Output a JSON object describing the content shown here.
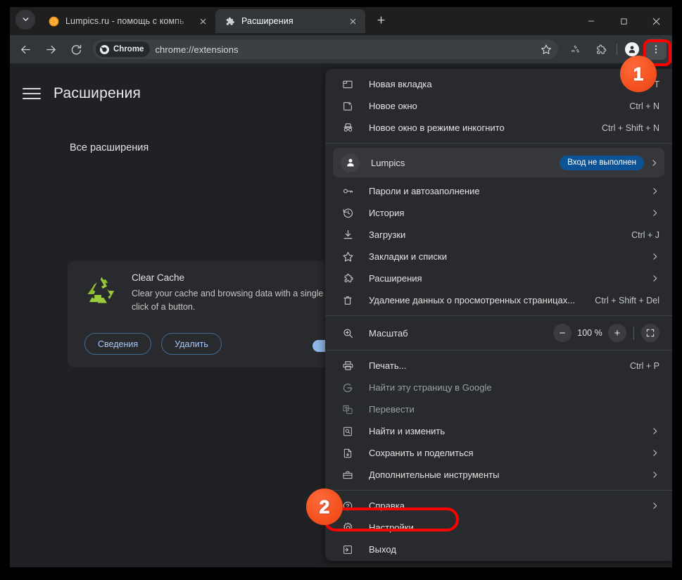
{
  "window": {
    "controls": {
      "minimize": "minimize-icon",
      "maximize": "maximize-icon",
      "close": "close-icon"
    }
  },
  "tabstrip": {
    "tab_search_icon": "chevron-down-icon",
    "new_tab_label": "+",
    "tabs": [
      {
        "title": "Lumpics.ru - помощь с компь",
        "favicon": "orange-favicon",
        "active": false,
        "close": "×"
      },
      {
        "title": "Расширения",
        "favicon": "puzzle-icon",
        "active": true,
        "close": "×"
      }
    ]
  },
  "toolbar": {
    "back_icon": "back-arrow-icon",
    "forward_icon": "forward-arrow-icon",
    "reload_icon": "reload-icon",
    "chip_label": "Chrome",
    "url": "chrome://extensions",
    "star_icon": "star-icon",
    "recycle_icon": "recycle-extension-icon",
    "extensions_icon": "puzzle-icon",
    "avatar_icon": "profile-avatar-icon",
    "menu_icon": "three-dot-menu-icon"
  },
  "page": {
    "title": "Расширения",
    "section_title": "Все расширения",
    "extension": {
      "name": "Clear Cache",
      "description": "Clear your cache and browsing data with a single click of a button.",
      "details_label": "Сведения",
      "remove_label": "Удалить",
      "enabled": true,
      "icon": "recycle-icon"
    }
  },
  "menu": {
    "groups": [
      {
        "items": [
          {
            "icon": "new-tab-icon",
            "label": "Новая вкладка",
            "accel": "Ctrl + T",
            "arrow": false
          },
          {
            "icon": "new-window-icon",
            "label": "Новое окно",
            "accel": "Ctrl + N",
            "arrow": false
          },
          {
            "icon": "incognito-icon",
            "label": "Новое окно в режиме инкогнито",
            "accel": "Ctrl + Shift + N",
            "arrow": false
          }
        ]
      },
      {
        "profile": {
          "icon": "person-icon",
          "name": "Lumpics",
          "badge": "Вход не выполнен",
          "arrow": true
        },
        "items": [
          {
            "icon": "key-icon",
            "label": "Пароли и автозаполнение",
            "accel": "",
            "arrow": true
          },
          {
            "icon": "history-icon",
            "label": "История",
            "accel": "",
            "arrow": true
          },
          {
            "icon": "download-icon",
            "label": "Загрузки",
            "accel": "Ctrl + J",
            "arrow": false
          },
          {
            "icon": "star-icon",
            "label": "Закладки и списки",
            "accel": "",
            "arrow": true
          },
          {
            "icon": "puzzle-icon",
            "label": "Расширения",
            "accel": "",
            "arrow": true
          },
          {
            "icon": "trash-icon",
            "label": "Удаление данных о просмотренных страницах...",
            "accel": "Ctrl + Shift + Del",
            "arrow": false
          }
        ]
      },
      {
        "zoom": {
          "icon": "zoom-icon",
          "label": "Масштаб",
          "minus": "−",
          "value": "100 %",
          "plus": "+",
          "fullscreen_icon": "fullscreen-icon"
        }
      },
      {
        "items": [
          {
            "icon": "print-icon",
            "label": "Печать...",
            "accel": "Ctrl + P",
            "arrow": false,
            "disabled": false
          },
          {
            "icon": "google-g-icon",
            "label": "Найти эту страницу в Google",
            "accel": "",
            "arrow": false,
            "disabled": true
          },
          {
            "icon": "translate-icon",
            "label": "Перевести",
            "accel": "",
            "arrow": false,
            "disabled": true
          },
          {
            "icon": "find-edit-icon",
            "label": "Найти и изменить",
            "accel": "",
            "arrow": true,
            "disabled": false
          },
          {
            "icon": "save-share-icon",
            "label": "Сохранить и поделиться",
            "accel": "",
            "arrow": true,
            "disabled": false
          },
          {
            "icon": "toolbox-icon",
            "label": "Дополнительные инструменты",
            "accel": "",
            "arrow": true,
            "disabled": false
          }
        ]
      },
      {
        "items": [
          {
            "icon": "help-icon",
            "label": "Справка",
            "accel": "",
            "arrow": true
          },
          {
            "icon": "gear-icon",
            "label": "Настройки",
            "accel": "",
            "arrow": false
          },
          {
            "icon": "exit-icon",
            "label": "Выход",
            "accel": "",
            "arrow": false
          }
        ]
      }
    ]
  },
  "annotations": {
    "step1": "1",
    "step2": "2",
    "highlight_color": "#ff0000",
    "badge_color": "#f4511e"
  }
}
